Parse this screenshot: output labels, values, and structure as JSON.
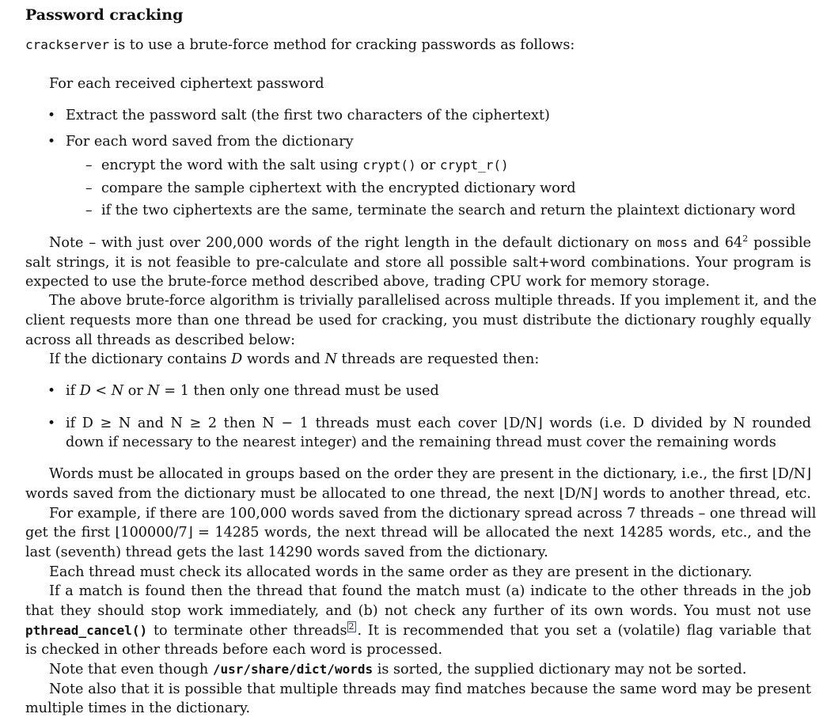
{
  "heading": "Password cracking",
  "intro": {
    "code": "crackserver",
    "text": " is to use a brute-force method for cracking passwords as follows:"
  },
  "algorithm": {
    "lead": "For each received ciphertext password",
    "b1": "Extract the password salt (the first two characters of the ciphertext)",
    "b2": "For each word saved from the dictionary",
    "d1_pre": "encrypt the word with the salt using ",
    "d1_code1": "crypt()",
    "d1_mid": " or ",
    "d1_code2": "crypt_r()",
    "d2": "compare the sample ciphertext with the encrypted dictionary word",
    "d3": "if the two ciphertexts are the same, terminate the search and return the plaintext dictionary word"
  },
  "note1": {
    "l1_pre": "Note – with just over 200,000 words of the right length in the default dictionary on ",
    "l1_code": "moss",
    "l1_mid": " and 64",
    "l1_sup": "2",
    "l1_post": " possible",
    "l2": "salt strings, it is not feasible to pre-calculate and store all possible salt+word combinations. Your program is",
    "l3": "expected to use the brute-force method described above, trading CPU work for memory storage."
  },
  "para2": {
    "l1": "The above brute-force algorithm is trivially parallelised across multiple threads. If you implement it, and the",
    "l2": "client requests more than one thread be used for cracking, you must distribute the dictionary roughly equally",
    "l3": "across all threads as described below:"
  },
  "cond": {
    "pre": "If the dictionary contains ",
    "D": "D",
    "mid": " words and ",
    "N": "N",
    "post": " threads are requested then:"
  },
  "rule1": {
    "t1": "if ",
    "t2": "D < N",
    "t3": " or ",
    "t4": "N",
    "t5": " = 1 then only one thread must be used"
  },
  "rule2": {
    "l1": "if D ≥ N and N ≥ 2 then N − 1 threads must each cover ⌊D/N⌋ words (i.e. D divided by N rounded",
    "l2": "down if necessary to the nearest integer) and the remaining thread must cover the remaining words"
  },
  "para3": {
    "l1": "Words must be allocated in groups based on the order they are present in the dictionary, i.e., the first ⌊D/N⌋",
    "l2": "words saved from the dictionary must be allocated to one thread, the next ⌊D/N⌋ words to another thread, etc."
  },
  "para4": {
    "l1": "For example, if there are 100,000 words saved from the dictionary spread across 7 threads – one thread will",
    "l2": "get the first ⌊100000/7⌋ = 14285 words, the next thread will be allocated the next 14285 words, etc., and the",
    "l3": "last (seventh) thread gets the last 14290 words saved from the dictionary."
  },
  "para5": "Each thread must check its allocated words in the same order as they are present in the dictionary.",
  "para6": {
    "l1": "If a match is found then the thread that found the match must (a) indicate to the other threads in the job",
    "l2": "that they should stop work immediately, and (b) not check any further of its own words. You must not use",
    "l3_code": "pthread_cancel()",
    "l3_mid": " to terminate other threads",
    "l3_ref": "2",
    "l3_post": ". It is recommended that you set a (volatile) flag variable that",
    "l4": "is checked in other threads before each word is processed."
  },
  "para7": {
    "pre": "Note that even though ",
    "code": "/usr/share/dict/words",
    "post": " is sorted, the supplied dictionary may not be sorted."
  },
  "para8": {
    "l1": "Note also that it is possible that multiple threads may find matches because the same word may be present",
    "l2": "multiple times in the dictionary."
  }
}
